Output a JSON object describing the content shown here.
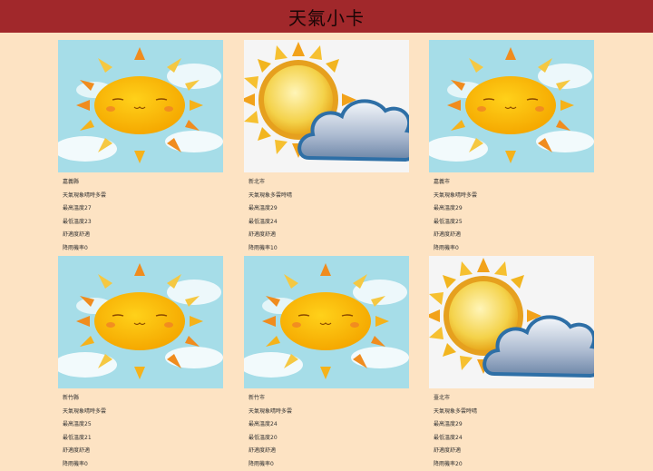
{
  "header": {
    "title": "天氣小卡"
  },
  "cards": [
    {
      "city": "嘉義縣",
      "desc": "天氣現象晴時多雲",
      "max": "最高溫度27",
      "min": "最低溫度23",
      "comfort": "舒適度舒適",
      "rain": "降雨機率0",
      "icon": "sunny-icon"
    },
    {
      "city": "新北市",
      "desc": "天氣現象多雲時晴",
      "max": "最高溫度29",
      "min": "最低溫度24",
      "comfort": "舒適度舒適",
      "rain": "降雨機率10",
      "icon": "partly-cloudy-icon"
    },
    {
      "city": "嘉義市",
      "desc": "天氣現象晴時多雲",
      "max": "最高溫度29",
      "min": "最低溫度25",
      "comfort": "舒適度舒適",
      "rain": "降雨機率0",
      "icon": "sunny-icon"
    },
    {
      "city": "新竹縣",
      "desc": "天氣現象晴時多雲",
      "max": "最高溫度25",
      "min": "最低溫度21",
      "comfort": "舒適度舒適",
      "rain": "降雨機率0",
      "icon": "sunny-icon"
    },
    {
      "city": "新竹市",
      "desc": "天氣現象晴時多雲",
      "max": "最高溫度24",
      "min": "最低溫度20",
      "comfort": "舒適度舒適",
      "rain": "降雨機率0",
      "icon": "sunny-icon"
    },
    {
      "city": "臺北市",
      "desc": "天氣現象多雲時晴",
      "max": "最高溫度29",
      "min": "最低溫度24",
      "comfort": "舒適度舒適",
      "rain": "降雨機率20",
      "icon": "partly-cloudy-icon"
    }
  ]
}
